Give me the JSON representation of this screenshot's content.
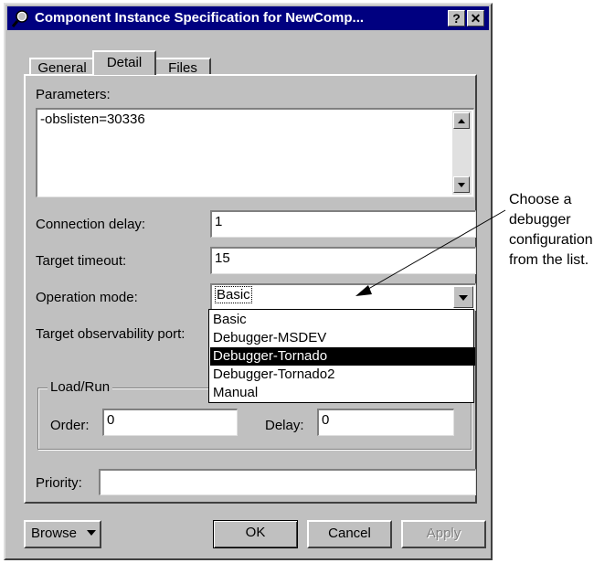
{
  "window": {
    "title": "Component Instance Specification for NewComp...",
    "help_label": "?",
    "close_label": "✕"
  },
  "tabs": [
    {
      "label": "General",
      "active": false
    },
    {
      "label": "Detail",
      "active": true
    },
    {
      "label": "Files",
      "active": false
    }
  ],
  "parameters": {
    "label": "Parameters:",
    "value": "-obslisten=30336"
  },
  "connection_delay": {
    "label": "Connection delay:",
    "value": "1"
  },
  "target_timeout": {
    "label": "Target timeout:",
    "value": "15"
  },
  "operation_mode": {
    "label": "Operation mode:",
    "value": "Basic",
    "options": [
      "Basic",
      "Debugger-MSDEV",
      "Debugger-Tornado",
      "Debugger-Tornado2",
      "Manual"
    ],
    "highlighted": "Debugger-Tornado"
  },
  "target_observability_port": {
    "label": "Target observability port:"
  },
  "load_run": {
    "group_label": "Load/Run",
    "order_label": "Order:",
    "order_value": "0",
    "delay_label": "Delay:",
    "delay_value": "0"
  },
  "priority": {
    "label": "Priority:",
    "value": ""
  },
  "buttons": {
    "browse": "Browse",
    "ok": "OK",
    "cancel": "Cancel",
    "apply": "Apply"
  },
  "annotation": {
    "lines": [
      "Choose a",
      "debugger",
      "configuration",
      "from the list."
    ]
  }
}
